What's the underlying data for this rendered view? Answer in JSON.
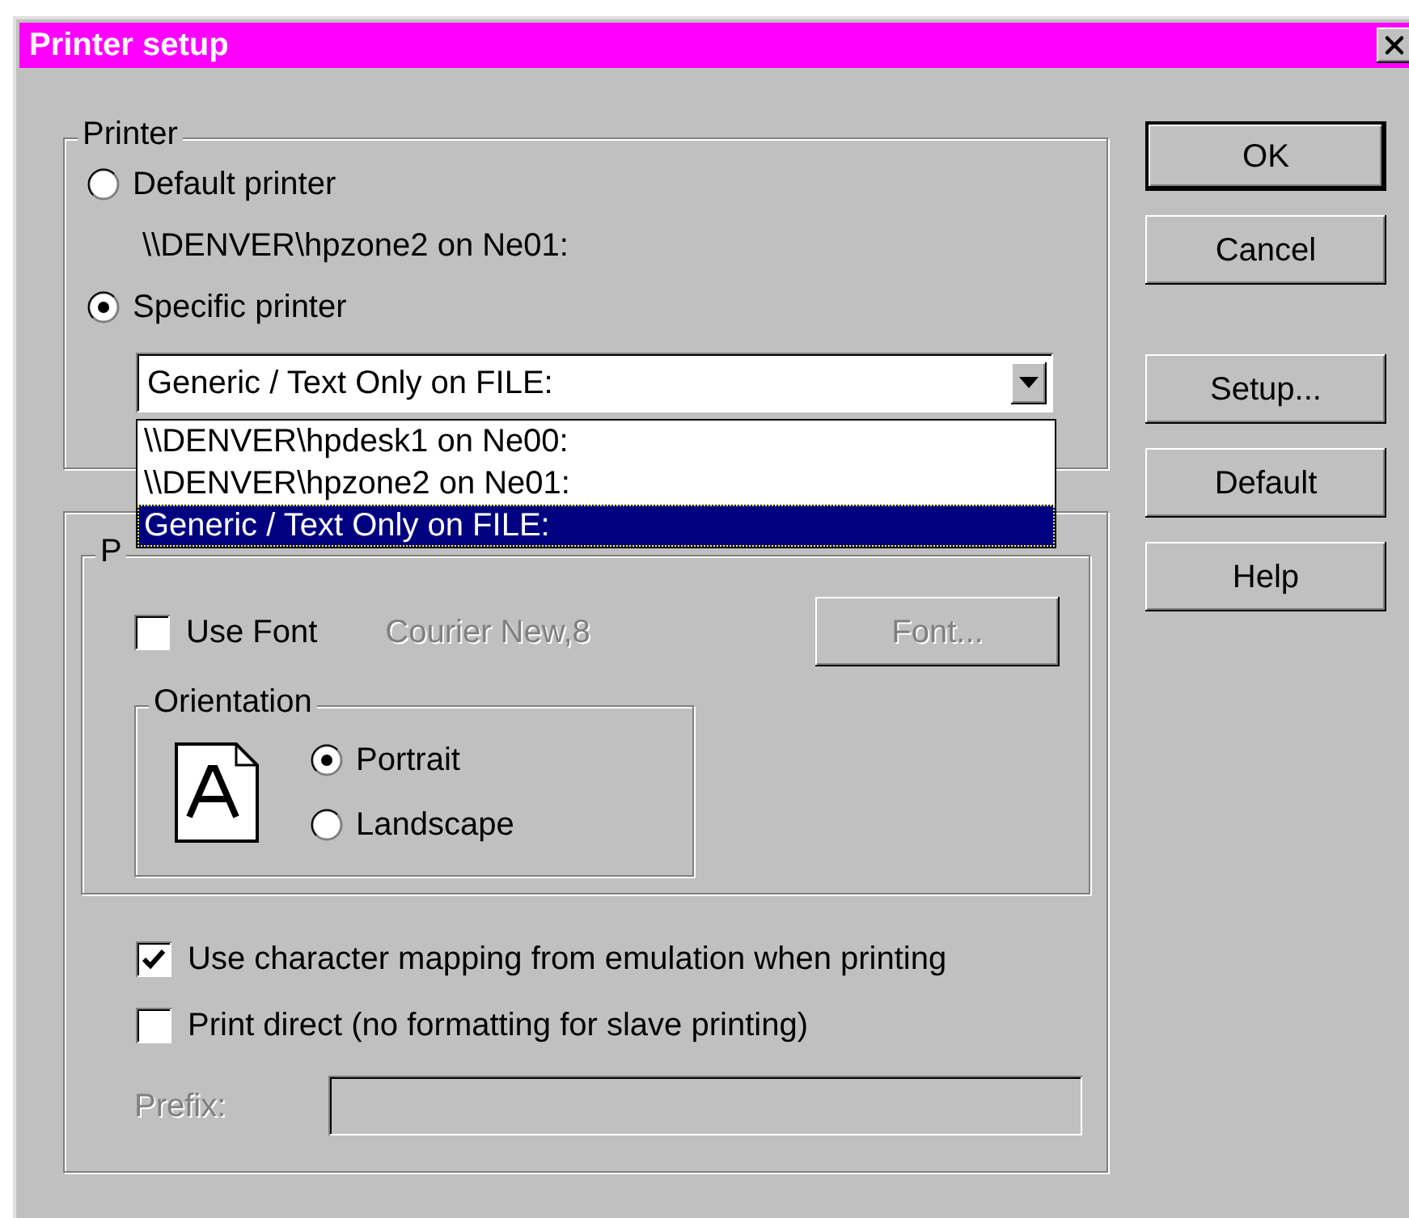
{
  "window": {
    "title": "Printer setup"
  },
  "printer": {
    "label": "Printer",
    "options": [
      {
        "label": "Default printer",
        "selected": false,
        "detail": "\\\\DENVER\\hpzone2 on Ne01:"
      },
      {
        "label": "Specific printer",
        "selected": true
      }
    ],
    "combo": {
      "value": "Generic / Text Only on FILE:",
      "items": [
        {
          "label": "\\\\DENVER\\hpdesk1 on Ne00:",
          "selected": false
        },
        {
          "label": "\\\\DENVER\\hpzone2 on Ne01:",
          "selected": false
        },
        {
          "label": "Generic / Text Only on FILE:",
          "selected": true
        }
      ]
    }
  },
  "font_group": {
    "label": "P",
    "use_font": {
      "label": "Use Font",
      "checked": false
    },
    "font_name": {
      "text": "Courier New,8",
      "disabled": true
    },
    "font_button": {
      "label": "Font...",
      "disabled": true
    },
    "orientation": {
      "label": "Orientation",
      "options": [
        {
          "label": "Portrait",
          "selected": true
        },
        {
          "label": "Landscape",
          "selected": false
        }
      ]
    }
  },
  "options": [
    {
      "label": "Use character mapping from emulation when printing",
      "checked": true
    },
    {
      "label": "Print direct (no formatting for slave printing)",
      "checked": false
    }
  ],
  "prefix": {
    "label": "Prefix:",
    "disabled": true
  },
  "buttons": [
    {
      "label": "OK",
      "default": true
    },
    {
      "label": "Cancel",
      "default": false
    },
    {
      "label": "Setup...",
      "default": false
    },
    {
      "label": "Default",
      "default": false
    },
    {
      "label": "Help",
      "default": false
    }
  ]
}
